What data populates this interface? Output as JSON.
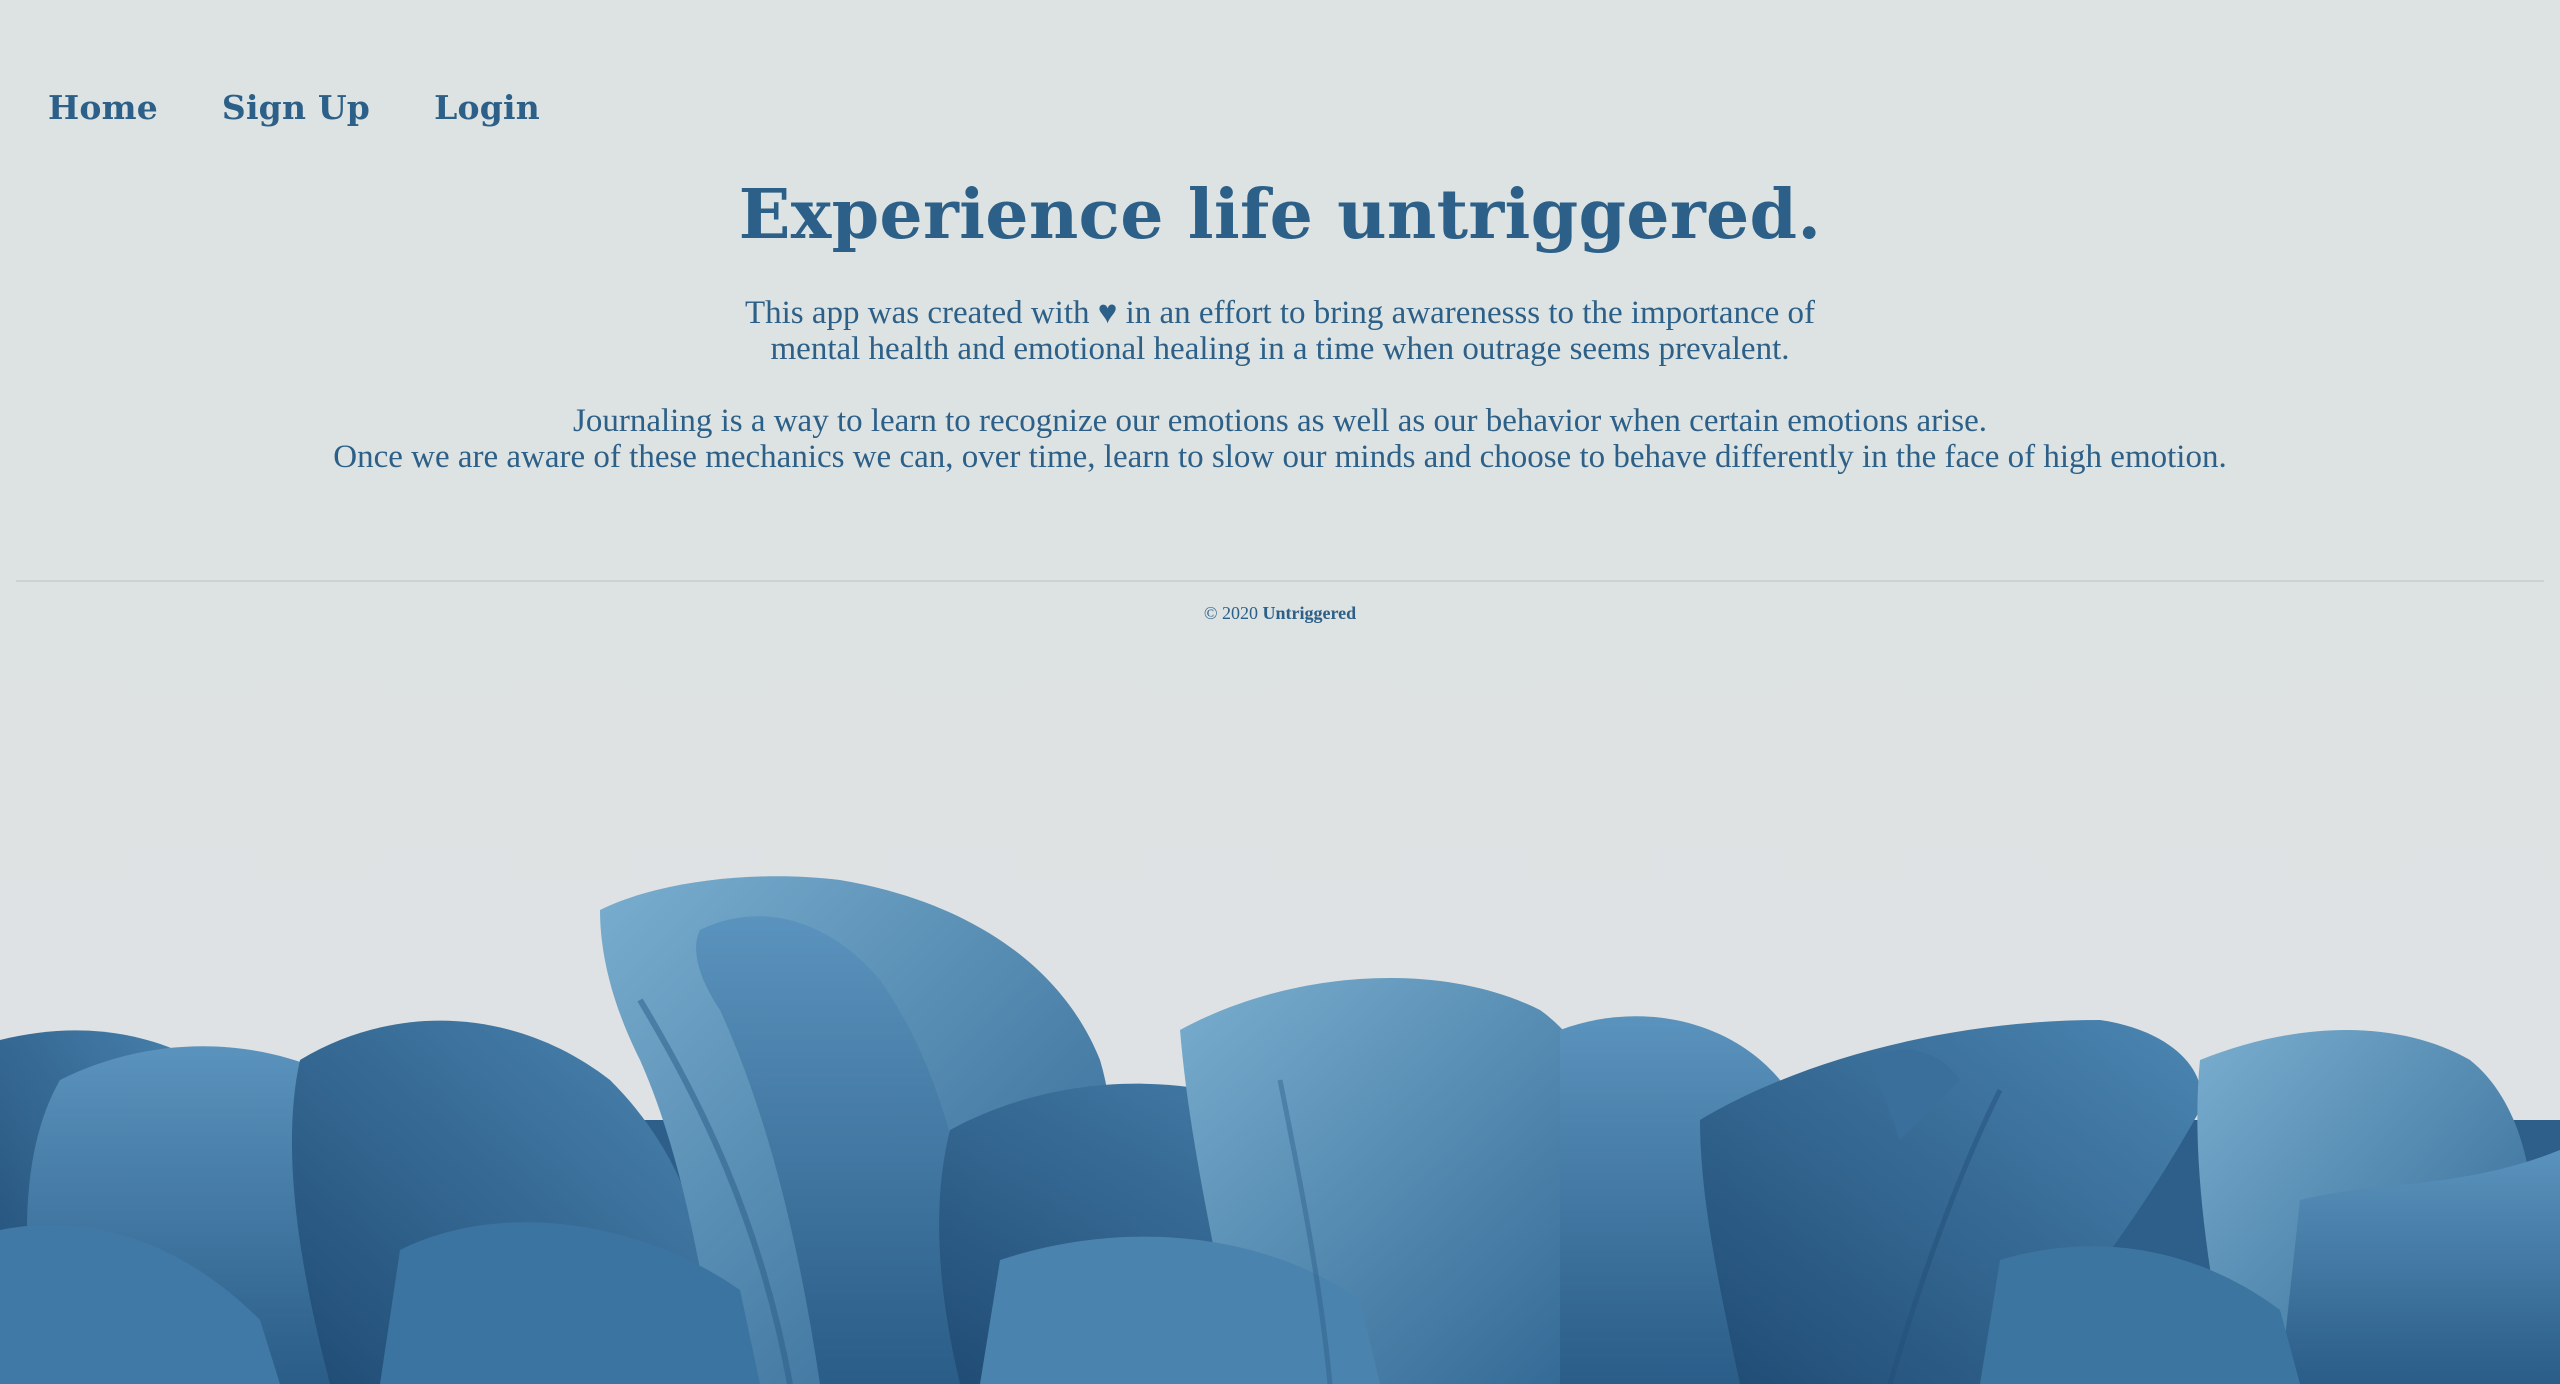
{
  "nav": {
    "items": [
      {
        "label": "Home"
      },
      {
        "label": "Sign Up"
      },
      {
        "label": "Login"
      }
    ]
  },
  "hero": {
    "title": "Experience life untriggered."
  },
  "intro": {
    "line1": "This app was created with ♥ in an effort to bring awarenesss to the importance of",
    "line2": "mental health and emotional healing in a time when outrage seems prevalent."
  },
  "journaling": {
    "line1": "Journaling is a way to learn to recognize our emotions as well as our behavior when certain emotions arise.",
    "line2": "Once we are aware of these mechanics we can, over time, learn to slow our minds and choose to behave differently in the face of high emotion."
  },
  "footer": {
    "copyright": "© 2020",
    "brand": "Untriggered"
  },
  "colors": {
    "text": "#2c6088",
    "background": "#dde2e2",
    "petal_dark": "#25557f",
    "petal_mid": "#3c74a1",
    "petal_light": "#6aa0c4"
  }
}
